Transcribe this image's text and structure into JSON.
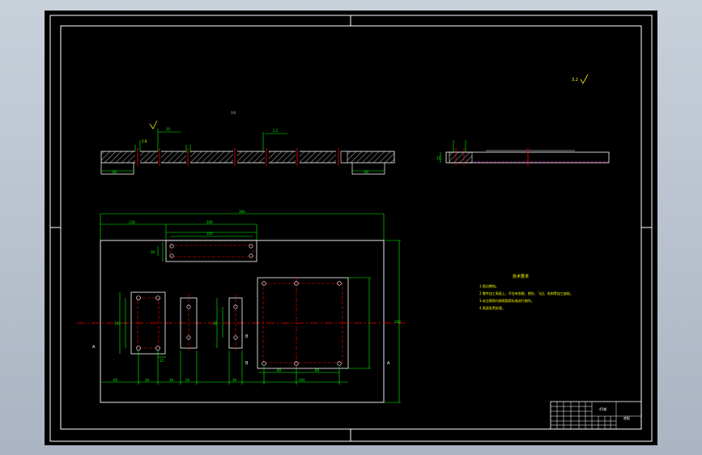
{
  "drawing": {
    "section_label": "I-I",
    "surface_finish_general": "3.2",
    "surface_finish_callout": "1.6",
    "top_view_dims": {
      "overall_width": "300",
      "upper_left": "130",
      "upper_mid": "200",
      "slot_top": "150",
      "left_height": "30",
      "right_height": "200",
      "left_rect_height": "100",
      "left_rect_width": "30",
      "small_offset": "15",
      "bottom_segments": [
        "65",
        "30",
        "30",
        "50",
        "30",
        "60",
        "60",
        "200"
      ]
    },
    "section_dims": {
      "left_step": "60",
      "right_step": "60",
      "top_note": "2.5",
      "thickness": "10"
    },
    "side_view": {
      "height_label": "15"
    },
    "section_marks": [
      "A",
      "A",
      "B",
      "B"
    ],
    "technical_requirements": {
      "title": "技术要求",
      "items": [
        "1.锐边倒钝。",
        "2.零件加工表面上，不应有划痕、擦伤、飞边、毛刺等加工缺陷。",
        "3.未注倒角均按照国家标准进行制作。",
        "4.表面发黑处理。"
      ]
    },
    "title_block": {
      "part_name": "底板",
      "material": "45钢"
    }
  },
  "colors": {
    "background": "#000000",
    "outline": "#ffffff",
    "dimension": "#00ff00",
    "centerline": "#ff0000",
    "hatch": "#ffffff",
    "hidden": "#ff00ff",
    "text_yellow": "#ffff00"
  }
}
